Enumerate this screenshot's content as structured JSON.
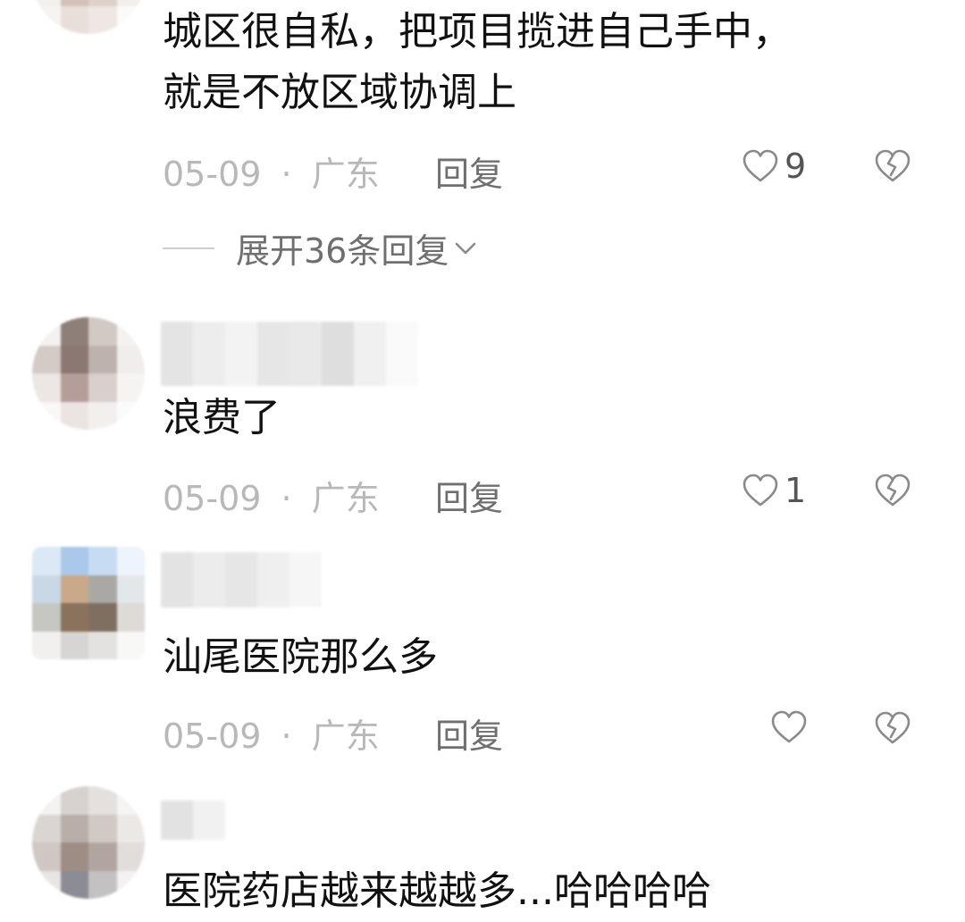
{
  "comments": [
    {
      "text_lines": [
        "城区很自私，把项目揽进自己手中，",
        "就是不放区域协调上"
      ],
      "date": "05-09",
      "separator": "·",
      "location": "广东",
      "reply_label": "回复",
      "likes": "9",
      "expand_replies_label": "展开36条回复"
    },
    {
      "text": "浪费了",
      "date": "05-09",
      "separator": "·",
      "location": "广东",
      "reply_label": "回复",
      "likes": "1"
    },
    {
      "text": "汕尾医院那么多",
      "date": "05-09",
      "separator": "·",
      "location": "广东",
      "reply_label": "回复",
      "likes": ""
    },
    {
      "text": "医院药店越来越越多...哈哈哈哈"
    }
  ],
  "icons": {
    "like": "heart-outline-icon",
    "dislike": "broken-heart-icon",
    "expand": "chevron-down-icon"
  },
  "colors": {
    "text": "#111111",
    "meta": "#b8b8b8",
    "action": "#6f6f6f",
    "icon": "#8a8a8a"
  }
}
